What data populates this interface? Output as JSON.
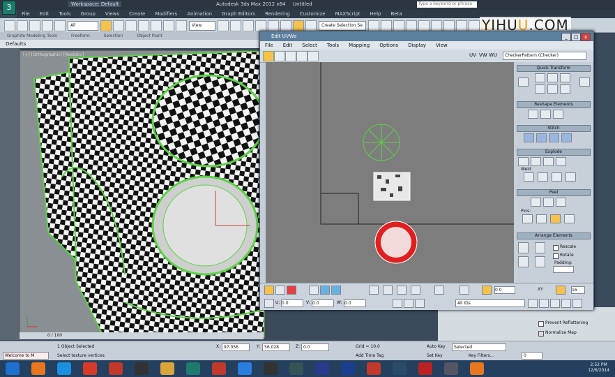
{
  "app": {
    "title": "Autodesk 3ds Max 2012 x64",
    "document": "Untitled",
    "workspace": "Workspace: Default",
    "search_placeholder": "Type a keyword or phrase"
  },
  "menubar": [
    "File",
    "Edit",
    "Tools",
    "Group",
    "Views",
    "Create",
    "Modifiers",
    "Animation",
    "Graph Editors",
    "Rendering",
    "Customize",
    "MAXScript",
    "Help",
    "Beta"
  ],
  "toolbar": {
    "filter": "All",
    "view_dropdown": "View",
    "selection_set": "Create Selection Se"
  },
  "ribbon": {
    "tabs": [
      "Graphite Modeling Tools",
      "Freeform",
      "Selection",
      "Object Paint"
    ],
    "defaults_label": "Defaults"
  },
  "viewport": {
    "label": "[+] [Orthographic] [Realistic]",
    "frame": "0 / 100"
  },
  "uvw": {
    "title": "Edit UVWs",
    "menus": [
      "File",
      "Edit",
      "Select",
      "Tools",
      "Mapping",
      "Options",
      "Display",
      "View"
    ],
    "map_dropdown": "CheckerPattern (Checker)",
    "uv_labels": [
      "UV",
      "VW",
      "WU"
    ],
    "rollouts": {
      "quick_transform": "Quick Transform",
      "reshape": "Reshape Elements",
      "stitch": "Stitch",
      "explode": "Explode",
      "weld": "Weld",
      "peel": "Peel",
      "pins": "Pins:",
      "arrange": "Arrange Elements",
      "rescale": "Rescale",
      "rotate": "Rotate",
      "padding": "Padding:"
    },
    "bottom": {
      "u_value": "0.0",
      "v_value": "0.0",
      "w_value": "0.0",
      "uv_value": "0.0",
      "xy_label": "XY",
      "zoom_value": "16",
      "show_map": "All IDs"
    }
  },
  "status": {
    "selected": "1 Object Selected",
    "prompt": "Select texture vertices",
    "welcome": "Welcome to M",
    "x_label": "X:",
    "x_value": "97.056",
    "y_label": "Y:",
    "y_value": "56.028",
    "z_label": "Z:",
    "z_value": "0.0",
    "grid": "Grid = 10.0",
    "add_time_tag": "Add Time Tag",
    "auto_key": "Auto Key",
    "auto_key_value": "Selected",
    "set_key": "Set Key",
    "key_filters": "Key Filters...",
    "frame_value": "0"
  },
  "rightpanel": {
    "prevent_reflattening": "Prevent Reflattening",
    "normalize_map": "Normalize Map"
  },
  "taskbar": {
    "icons": [
      "start-orb",
      "firefox",
      "ie",
      "chrome",
      "filezilla",
      "media",
      "folder",
      "3dsmax",
      "filezilla2",
      "dropbox",
      "player",
      "monitor",
      "photoshop-alt",
      "photoshop",
      "autodesk",
      "screen",
      "pdf",
      "video",
      "vlc"
    ],
    "time": "2:52 PM",
    "date": "12/6/2014"
  },
  "watermark": {
    "text_left": "YIHU",
    "text_highlight": "U",
    "text_right": ".COM"
  },
  "colors": {
    "green_seam": "#5bd245",
    "red_element": "#e02020",
    "accent": "#f6c24a"
  }
}
